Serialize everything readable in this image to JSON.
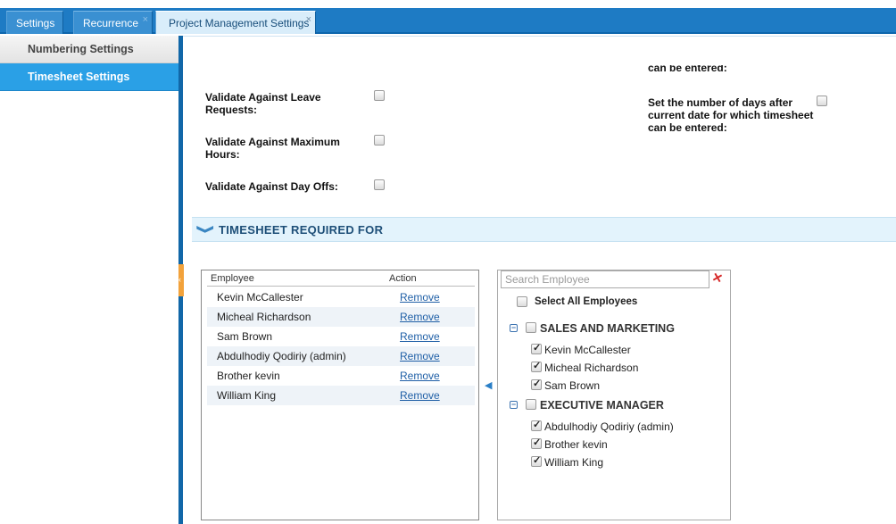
{
  "tabs": [
    {
      "label": "Settings",
      "close": ""
    },
    {
      "label": "Recurrence",
      "close": "×"
    },
    {
      "label": "Project Management Settings",
      "close": "×"
    }
  ],
  "sidebar": {
    "items": [
      {
        "label": "Numbering Settings"
      },
      {
        "label": "Timesheet Settings"
      }
    ]
  },
  "form": {
    "cut_off_text": "can be entered:",
    "validate_leave": "Validate Against Leave Requests:",
    "validate_max_hours": "Validate Against Maximum Hours:",
    "validate_day_offs": "Validate Against Day Offs:",
    "days_after": "Set the number of days after current date for which timesheet can be entered:"
  },
  "section": {
    "chevron": "❯",
    "title": "TIMESHEET REQUIRED FOR"
  },
  "table": {
    "headers": {
      "employee": "Employee",
      "action": "Action"
    },
    "rows": [
      {
        "name": "Kevin McCallester",
        "action": "Remove"
      },
      {
        "name": "Micheal Richardson",
        "action": "Remove"
      },
      {
        "name": "Sam Brown",
        "action": "Remove"
      },
      {
        "name": "Abdulhodiy Qodiriy (admin)",
        "action": "Remove"
      },
      {
        "name": "Brother kevin",
        "action": "Remove"
      },
      {
        "name": "William King",
        "action": "Remove"
      }
    ]
  },
  "picker": {
    "search_placeholder": "Search Employee",
    "select_all": "Select All Employees",
    "groups": [
      {
        "name": "SALES AND MARKETING",
        "members": [
          "Kevin McCallester",
          "Micheal Richardson",
          "Sam Brown"
        ]
      },
      {
        "name": "EXECUTIVE MANAGER",
        "members": [
          "Abdulhodiy Qodiriy (admin)",
          "Brother kevin",
          "William King"
        ]
      }
    ]
  },
  "icons": {
    "move_left": "◀",
    "clear_search": "✕",
    "collapse": "−",
    "grip": "‹"
  },
  "colors": {
    "accent": "#1e7bc4",
    "selected_nav": "#2aa0e6",
    "section_bg": "#e3f3fc",
    "link": "#1f5fa6"
  }
}
